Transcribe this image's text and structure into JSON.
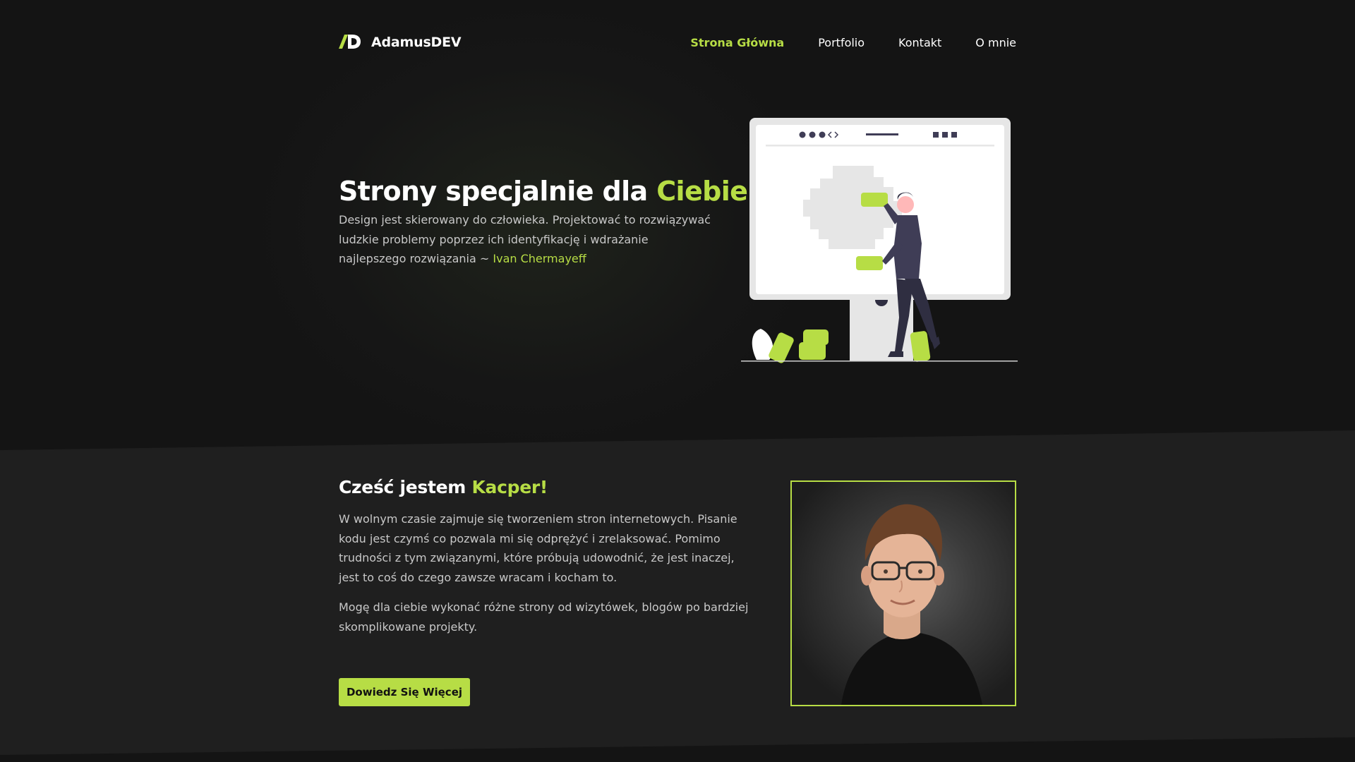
{
  "brand": {
    "logo_icon": "ad-logo-icon",
    "name": "AdamusDEV"
  },
  "nav": {
    "items": [
      {
        "label": "Strona Główna",
        "active": true
      },
      {
        "label": "Portfolio",
        "active": false
      },
      {
        "label": "Kontakt",
        "active": false
      },
      {
        "label": "O mnie",
        "active": false
      }
    ]
  },
  "hero": {
    "title_prefix": "Strony specjalnie dla",
    "title_accent": "Ciebie",
    "quote": "Design jest skierowany do człowieka. Projektować to rozwiązywać ludzkie problemy poprzez ich identyfikację i wdrażanie najlepszego rozwiązania ~",
    "quote_author": "Ivan Chermayeff",
    "illustration_icon": "web-design-illustration"
  },
  "about": {
    "title_prefix": "Cześć jestem",
    "title_accent": "Kacper!",
    "paragraph_1": "W wolnym czasie zajmuje się tworzeniem stron internetowych. Pisanie kodu jest czymś co pozwala mi się odprężyć i zrelaksować. Pomimo trudności z tym związanymi, które próbują udowodnić, że jest inaczej, jest to coś do czego zawsze wracam i kocham to.",
    "paragraph_2": "Mogę dla ciebie wykonać różne strony od wizytówek, blogów po bardziej skomplikowane projekty.",
    "cta_label": "Dowiedz Się Więcej",
    "photo_icon": "profile-photo"
  },
  "colors": {
    "accent": "#b7dd45",
    "background": "#141414",
    "section": "#1f1f1f",
    "text_muted": "#c8c8c8"
  }
}
